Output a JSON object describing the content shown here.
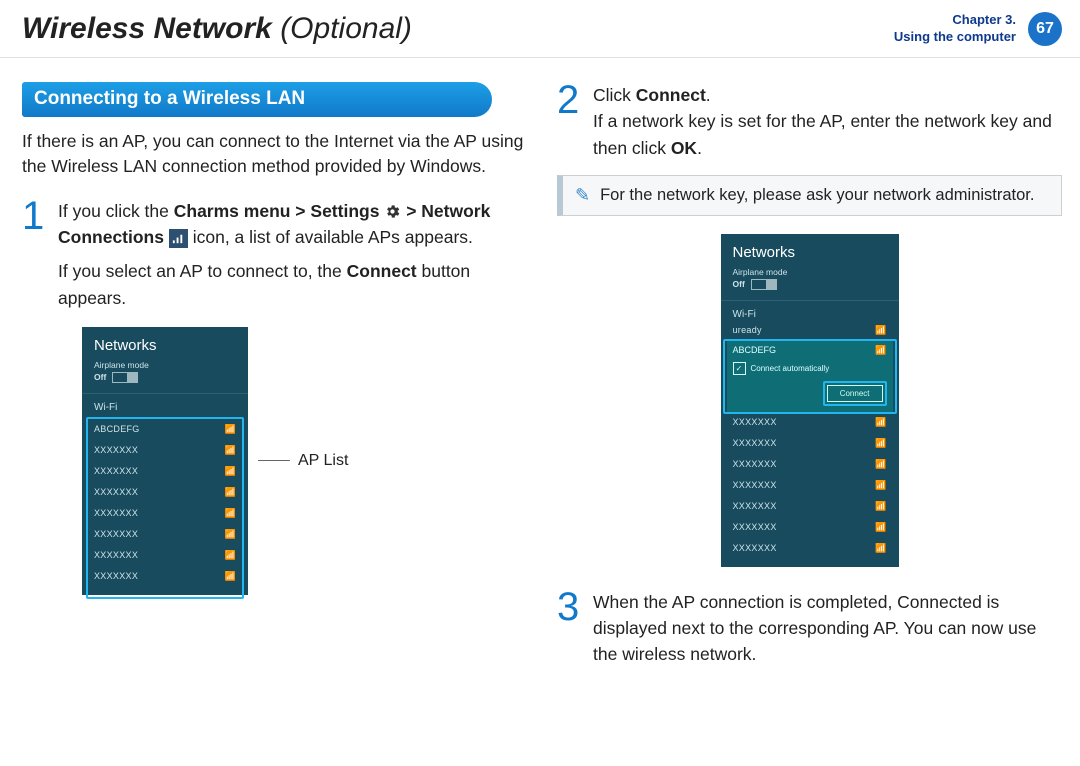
{
  "header": {
    "title_main": "Wireless Network",
    "title_sub": "(Optional)",
    "chapter_label": "Chapter 3.",
    "chapter_sub": "Using the computer",
    "page_number": "67"
  },
  "section_title": "Connecting to a Wireless LAN",
  "intro": "If there is an AP, you can connect to the Internet via the AP using the Wireless LAN connection method provided by Windows.",
  "step1": {
    "num": "1",
    "text_a": "If you click the ",
    "kw_charms": "Charms menu > Settings",
    "text_b": " > ",
    "kw_net": "Network Connections",
    "text_c": " icon, a list of available APs appears.",
    "text_d": "If you select an AP to connect to, the ",
    "kw_connect": "Connect",
    "text_e": " button appears.",
    "ap_list_label": "AP List"
  },
  "step2": {
    "num": "2",
    "text_a": "Click ",
    "kw_connect": "Connect",
    "period": ".",
    "text_b": "If a network key is set for the AP, enter the network key and then click ",
    "kw_ok": "OK",
    "period2": "."
  },
  "note": "For the network key, please ask your network administrator.",
  "step3": {
    "num": "3",
    "text": "When the AP connection is completed, Connected is displayed next to the corresponding AP. You can now use the wireless network."
  },
  "panel_common": {
    "title": "Networks",
    "airplane": "Airplane mode",
    "off": "Off",
    "wifi": "Wi-Fi"
  },
  "panel1": {
    "items": [
      {
        "name": "ABCDEFG"
      },
      {
        "name": "XXXXXXX"
      },
      {
        "name": "XXXXXXX"
      },
      {
        "name": "XXXXXXX"
      },
      {
        "name": "XXXXXXX"
      },
      {
        "name": "XXXXXXX"
      },
      {
        "name": "XXXXXXX"
      },
      {
        "name": "XXXXXXX"
      }
    ]
  },
  "panel2": {
    "uready": "uready",
    "selected": "ABCDEFG",
    "auto": "Connect automatically",
    "connect_btn": "Connect",
    "items": [
      {
        "name": "XXXXXXX"
      },
      {
        "name": "XXXXXXX"
      },
      {
        "name": "XXXXXXX"
      },
      {
        "name": "XXXXXXX"
      },
      {
        "name": "XXXXXXX"
      },
      {
        "name": "XXXXXXX"
      },
      {
        "name": "XXXXXXX"
      }
    ]
  }
}
